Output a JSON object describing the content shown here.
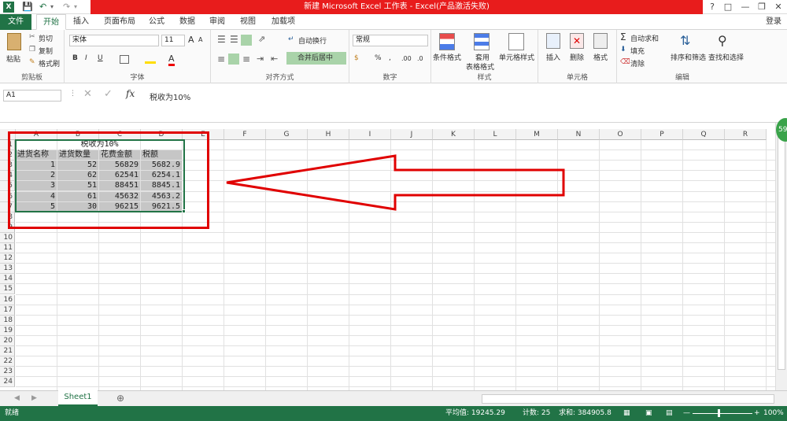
{
  "title": "新建 Microsoft Excel 工作表 - Excel(产品激活失败)",
  "login": "登录",
  "tabs": [
    "文件",
    "开始",
    "插入",
    "页面布局",
    "公式",
    "数据",
    "审阅",
    "视图",
    "加载项"
  ],
  "ribbon": {
    "clipboard": {
      "paste": "粘贴",
      "cut": "剪切",
      "copy": "复制",
      "format_painter": "格式刷",
      "label": "剪贴板"
    },
    "font": {
      "name": "宋体",
      "size": "11",
      "bold": "B",
      "italic": "I",
      "underline": "U",
      "grow": "A",
      "shrink": "A",
      "label": "字体"
    },
    "alignment": {
      "wrap": "自动换行",
      "merge": "合并后居中",
      "label": "对齐方式"
    },
    "number": {
      "format": "常规",
      "percent": "%",
      "comma": ",",
      "inc": ".00",
      "dec": ".0",
      "label": "数字"
    },
    "styles": {
      "conditional": "条件格式",
      "table_l1": "套用",
      "table_l2": "表格格式",
      "cell_styles": "单元格样式",
      "label": "样式"
    },
    "cells": {
      "insert": "插入",
      "delete": "删除",
      "format": "格式",
      "label": "单元格"
    },
    "editing": {
      "autosum": "自动求和",
      "fill": "填充",
      "clear": "清除",
      "sort": "排序和筛选",
      "find": "查找和选择",
      "label": "编辑"
    }
  },
  "formula_bar": {
    "name_box": "A1",
    "fx": "fx",
    "content": "税收为10%"
  },
  "columns": [
    "A",
    "B",
    "C",
    "D",
    "E",
    "F",
    "G",
    "H",
    "I",
    "J",
    "K",
    "L",
    "M",
    "N",
    "O",
    "P",
    "Q",
    "R"
  ],
  "rows": [
    "1",
    "2",
    "3",
    "4",
    "5",
    "6",
    "7",
    "8",
    "9",
    "10",
    "11",
    "12",
    "13",
    "14",
    "15",
    "16",
    "17",
    "18",
    "19",
    "20",
    "21",
    "22",
    "23",
    "24"
  ],
  "sheet": {
    "merged_title": "税收为10%",
    "headers": [
      "进货名称",
      "进货数量",
      "花费金额",
      "税额"
    ],
    "data": [
      [
        "1",
        "52",
        "56829",
        "5682.9"
      ],
      [
        "2",
        "62",
        "62541",
        "6254.1"
      ],
      [
        "3",
        "51",
        "88451",
        "8845.1"
      ],
      [
        "4",
        "61",
        "45632",
        "4563.2"
      ],
      [
        "5",
        "30",
        "96215",
        "9621.5"
      ]
    ]
  },
  "sheet_tab": "Sheet1",
  "status": {
    "ready": "就绪",
    "average": "平均值: 19245.29",
    "count": "计数: 25",
    "sum": "求和: 384905.8",
    "zoom": "100%"
  },
  "badge": "59",
  "colors": {
    "excel_green": "#217346",
    "title_red": "#e81c1c",
    "annotation_red": "#e00000"
  }
}
